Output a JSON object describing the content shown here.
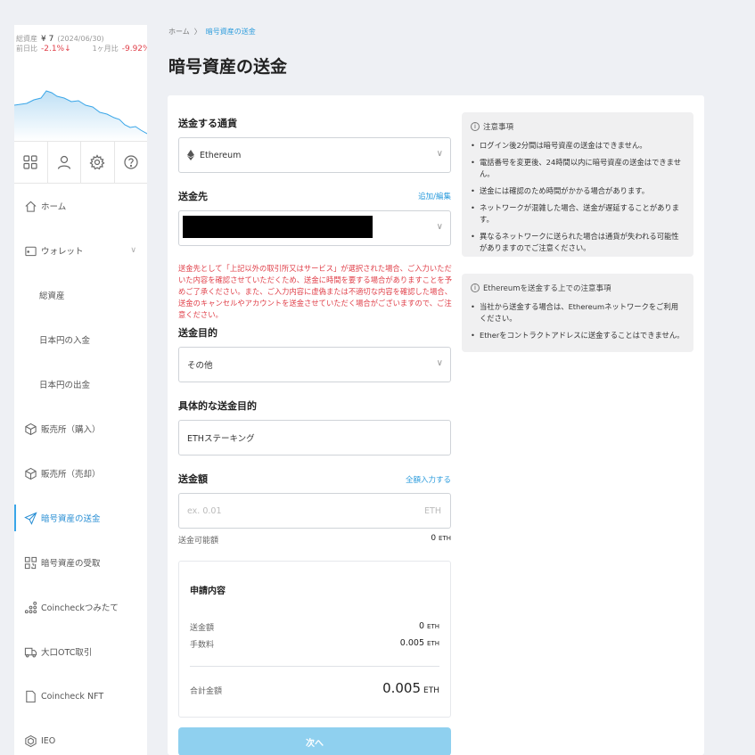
{
  "sidebar": {
    "summary": {
      "total_label": "総資産",
      "total_value": "¥ 7",
      "date": "(2024/06/30)",
      "day_label": "前日比",
      "day_change": "-2.1%↓",
      "month_label": "1ヶ月比",
      "month_change": "-9.92%↓"
    },
    "nav": {
      "home": "ホーム",
      "wallet": "ウォレット",
      "total_assets": "総資産",
      "jpy_deposit": "日本円の入金",
      "jpy_withdraw": "日本円の出金",
      "buy": "販売所（購入）",
      "sell": "販売所（売却）",
      "send_crypto": "暗号資産の送金",
      "receive_crypto": "暗号資産の受取",
      "tsumitate": "Coincheckつみたて",
      "otc": "大口OTC取引",
      "nft": "Coincheck NFT",
      "ieo": "IEO"
    }
  },
  "breadcrumb": {
    "home": "ホーム",
    "sep": "〉",
    "current": "暗号資産の送金"
  },
  "page_title": "暗号資産の送金",
  "form": {
    "currency_label": "送金する通貨",
    "currency_value": "Ethereum",
    "destination_label": "送金先",
    "destination_link": "追加/編集",
    "warning": "送金先として「上記以外の取引所又はサービス」が選択された場合、ご入力いただいた内容を確認させていただくため、送金に時間を要する場合がありますことを予めご了承ください。また、ご入力内容に虚偽または不適切な内容を確認した場合、送金のキャンセルやアカウントを送金させていただく場合がございますので、ご注意ください。",
    "purpose_label": "送金目的",
    "purpose_value": "その他",
    "specific_purpose_label": "具体的な送金目的",
    "specific_purpose_value": "ETHステーキング",
    "amount_label": "送金額",
    "amount_link": "全額入力する",
    "amount_placeholder": "ex. 0.01",
    "amount_unit": "ETH",
    "available_label": "送金可能額",
    "available_value": "0",
    "available_unit": "ETH"
  },
  "request_summary": {
    "title": "申請内容",
    "amount_label": "送金額",
    "amount_value": "0",
    "fee_label": "手数料",
    "fee_value": "0.005",
    "total_label": "合計金額",
    "total_value": "0.005",
    "unit": "ETH"
  },
  "next_button": "次へ",
  "notes": {
    "title": "注意事項",
    "items": [
      "ログイン後2分間は暗号資産の送金はできません。",
      "電話番号を変更後、24時間以内に暗号資産の送金はできません。",
      "送金には確認のため時間がかかる場合があります。",
      "ネットワークが混雑した場合、送金が遅延することがあります。",
      "異なるネットワークに送られた場合は通貨が失われる可能性がありますのでご注意ください。"
    ]
  },
  "eth_notes": {
    "title": "Ethereumを送金する上での注意事項",
    "items": [
      "当社から送金する場合は、Ethereumネットワークをご利用ください。",
      "Etherをコントラクトアドレスに送金することはできません。"
    ]
  },
  "colors": {
    "accent": "#2a9bdc",
    "warning": "#e0404a",
    "button": "#8fd0ef"
  }
}
